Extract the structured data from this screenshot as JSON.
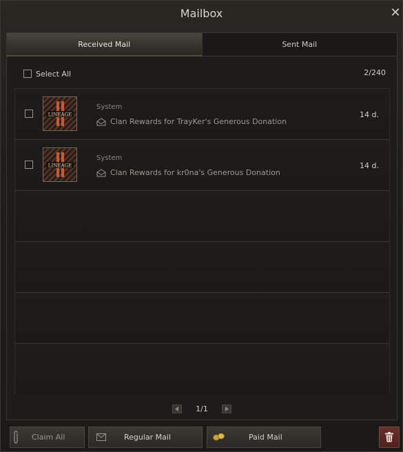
{
  "window": {
    "title": "Mailbox"
  },
  "tabs": [
    {
      "label": "Received Mail",
      "active": true
    },
    {
      "label": "Sent Mail",
      "active": false
    }
  ],
  "select_all_label": "Select All",
  "mail_count": "2/240",
  "mails": [
    {
      "sender": "System",
      "subject": "Clan Rewards for TrayKer's Generous Donation",
      "expires": "14 d.",
      "icon": "lineage-ii-logo-icon"
    },
    {
      "sender": "System",
      "subject": "Clan Rewards for kr0na's Generous Donation",
      "expires": "14 d.",
      "icon": "lineage-ii-logo-icon"
    }
  ],
  "pagination": {
    "label": "1/1"
  },
  "footer": {
    "claim_all": "Claim All",
    "regular_mail": "Regular Mail",
    "paid_mail": "Paid Mail"
  },
  "colors": {
    "accent_gold": "#c9a23a",
    "delete_red": "#6b2f2a"
  }
}
